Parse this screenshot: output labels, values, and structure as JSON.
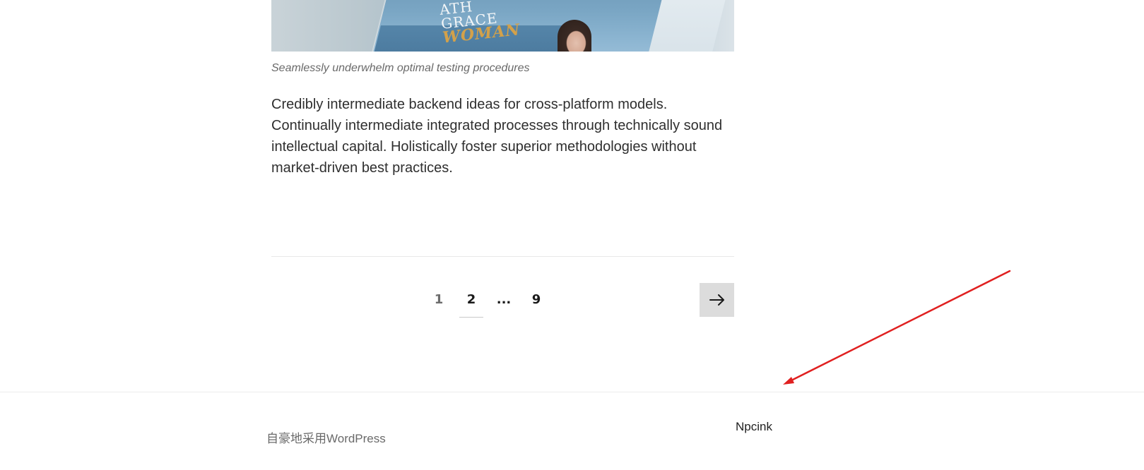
{
  "hero": {
    "image_name": "magazine-cover-photo",
    "cover_text_lines": [
      "ATH",
      "GRACE"
    ],
    "cover_text_accent": "WOMAN"
  },
  "post": {
    "caption": "Seamlessly underwhelm optimal testing procedures",
    "body": "Credibly intermediate backend ideas for cross-platform models. Continually intermediate integrated processes through technically sound intellectual capital. Holistically foster superior methodologies without market-driven best practices."
  },
  "pagination": {
    "pages": [
      {
        "label": "1",
        "state": "normal"
      },
      {
        "label": "2",
        "state": "current"
      },
      {
        "label": "...",
        "state": "dots"
      },
      {
        "label": "9",
        "state": "normal"
      }
    ],
    "next_icon": "arrow-right-icon"
  },
  "footer": {
    "credit": "自豪地采用WordPress",
    "site_name": "Npcink"
  },
  "colors": {
    "accent_arrow": "#e02020",
    "next_button_bg": "#dcdcdc",
    "caption": "#6a6a6a",
    "body_text": "#2f2f2f"
  }
}
